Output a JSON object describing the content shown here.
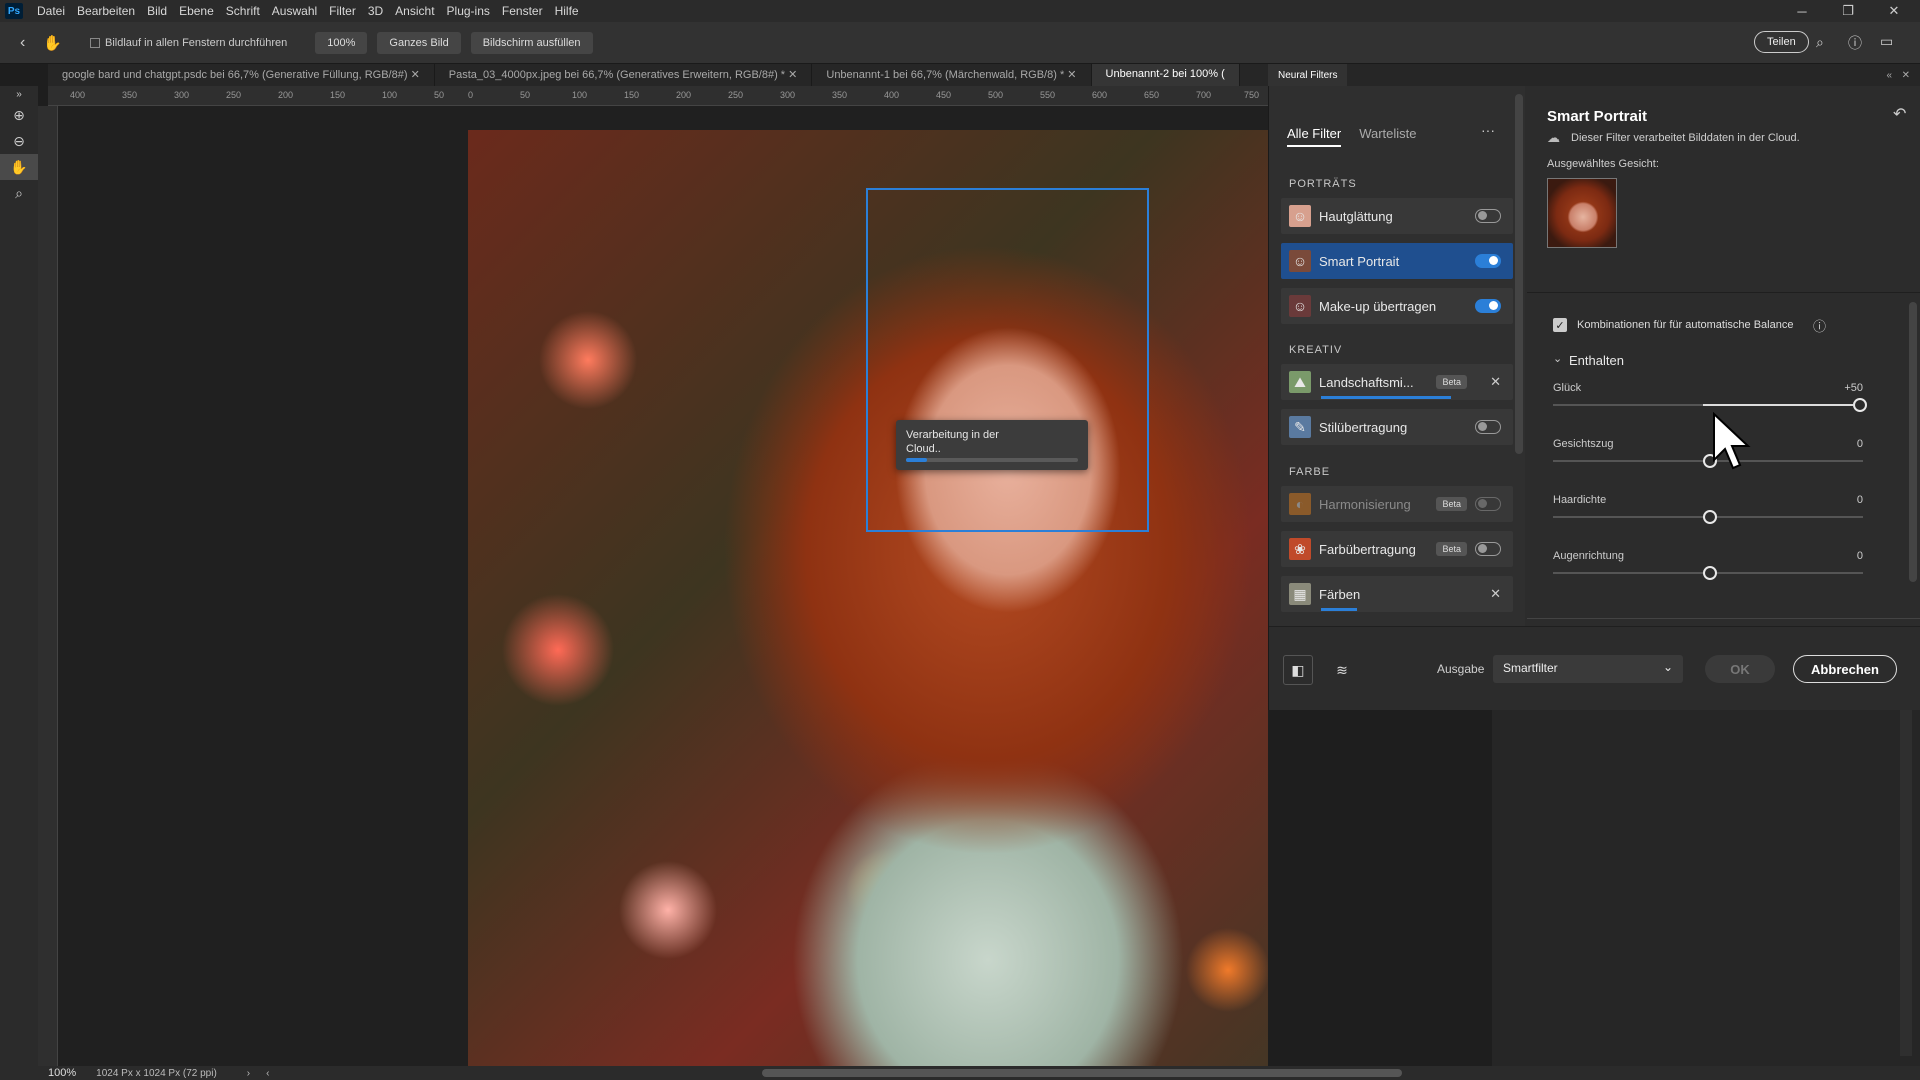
{
  "menubar": {
    "items": [
      "Datei",
      "Bearbeiten",
      "Bild",
      "Ebene",
      "Schrift",
      "Auswahl",
      "Filter",
      "3D",
      "Ansicht",
      "Plug-ins",
      "Fenster",
      "Hilfe"
    ],
    "app_logo": "Ps"
  },
  "optionsbar": {
    "scroll_all_label": "Bildlauf in allen Fenstern durchführen",
    "zoom_btn": "100%",
    "fit_btn": "Ganzes Bild",
    "fill_btn": "Bildschirm ausfüllen",
    "share_btn": "Teilen"
  },
  "tabs": [
    {
      "label": "google bard und chatgpt.psdc bei 66,7% (Generative Füllung, RGB/8#)",
      "active": false
    },
    {
      "label": "Pasta_03_4000px.jpeg bei 66,7% (Generatives Erweitern, RGB/8#) *",
      "active": false
    },
    {
      "label": "Unbenannt-1 bei 66,7% (Märchenwald, RGB/8) *",
      "active": false
    },
    {
      "label": "Unbenannt-2 bei 100% (",
      "active": true
    }
  ],
  "ruler": {
    "top_labels": [
      "400",
      "350",
      "300",
      "250",
      "200",
      "150",
      "100",
      "50",
      "0",
      "50",
      "100",
      "150",
      "200",
      "250",
      "300",
      "350",
      "400",
      "450",
      "500",
      "550",
      "600",
      "650",
      "700",
      "750"
    ]
  },
  "canvas": {
    "cloud_dialog": {
      "text": "Verarbeitung in der Cloud..",
      "progress_percent": 12
    }
  },
  "statusbar": {
    "zoom": "100%",
    "doc_size": "1024 Px x 1024 Px (72 ppi)"
  },
  "neural_filters": {
    "panel_title": "Neural Filters",
    "tabs": [
      "Alle Filter",
      "Warteliste"
    ],
    "more": "···",
    "sections": {
      "portraits": "PORTRÄTS",
      "kreativ": "KREATIV",
      "farbe": "FARBE"
    },
    "filters": {
      "hautglaettung": {
        "label": "Hautglättung",
        "on": false
      },
      "smart_portrait": {
        "label": "Smart Portrait",
        "on": true
      },
      "makeup": {
        "label": "Make-up übertragen",
        "on": true
      },
      "landschaft": {
        "label": "Landschaftsmi...",
        "badge": "Beta",
        "progress": 0.72
      },
      "stiluebertragung": {
        "label": "Stilübertragung",
        "on": false
      },
      "harmonisierung": {
        "label": "Harmonisierung",
        "badge": "Beta",
        "on": false
      },
      "farbuebertragung": {
        "label": "Farbübertragung",
        "badge": "Beta",
        "on": false
      },
      "faerben": {
        "label": "Färben",
        "progress": 0.2
      }
    },
    "settings": {
      "title": "Smart Portrait",
      "cloud_note": "Dieser Filter verarbeitet Bilddaten in der Cloud.",
      "selected_face_label": "Ausgewähltes Gesicht:",
      "auto_balance_label": "Kombinationen für für automatische Balance",
      "auto_balance_checked": true,
      "group_label": "Enthalten",
      "sliders": [
        {
          "name": "Glück",
          "value": "+50",
          "fraction": 1.0
        },
        {
          "name": "Gesichtszug",
          "value": "0",
          "fraction": 0.5
        },
        {
          "name": "Haardichte",
          "value": "0",
          "fraction": 0.5
        },
        {
          "name": "Augenrichtung",
          "value": "0",
          "fraction": 0.5
        }
      ]
    },
    "bottom": {
      "output_label": "Ausgabe",
      "output_value": "Smartfilter",
      "ok": "OK",
      "cancel": "Abbrechen"
    }
  },
  "colors": {
    "accent": "#2b7fd8",
    "panel_bg": "#2c2c2c"
  }
}
